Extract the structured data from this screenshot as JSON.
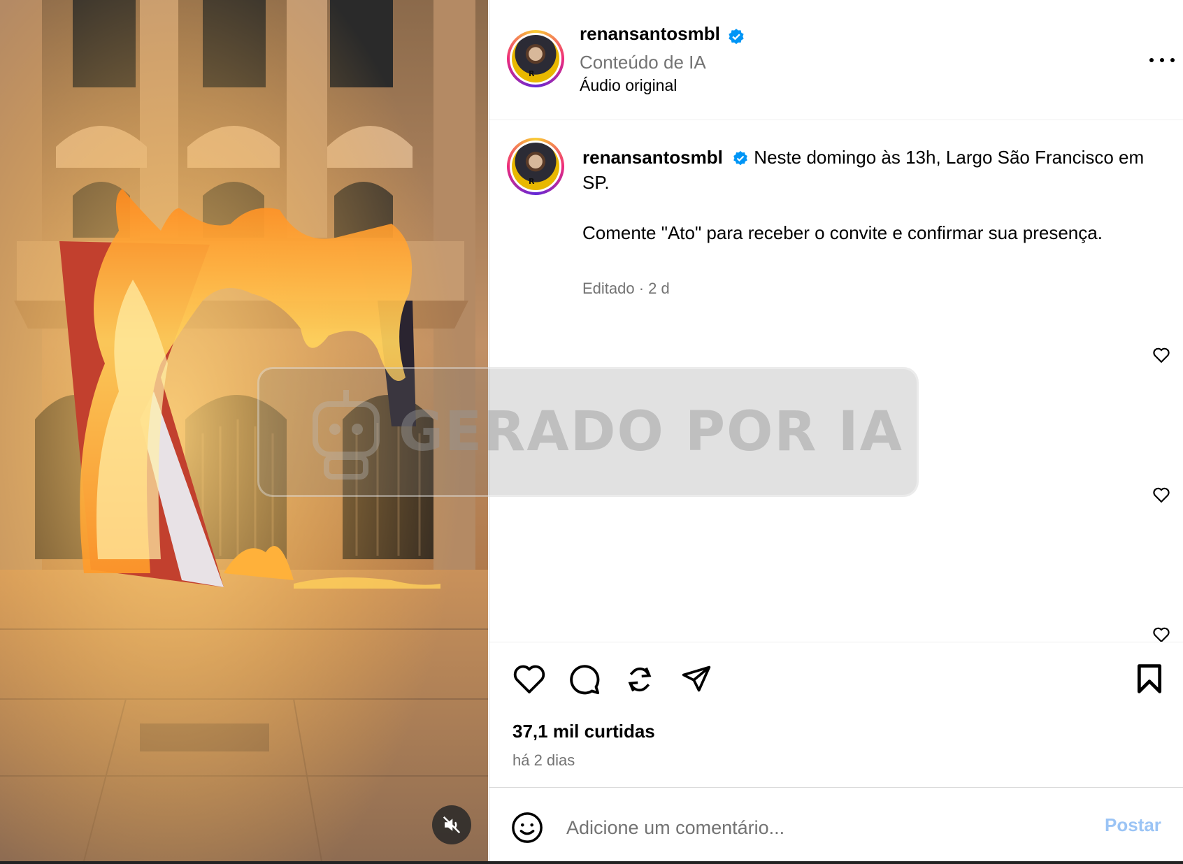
{
  "header": {
    "username": "renansantosmbl",
    "sub_label": "Conteúdo de IA",
    "audio_label": "Áudio original"
  },
  "caption": {
    "username": "renansantosmbl",
    "line1": "Neste domingo às 13h, Largo São Francisco em SP.",
    "line2": "Comente \"Ato\" para receber o convite e confirmar sua presença.",
    "meta": "Editado · 2 d"
  },
  "watermark": {
    "text": "GERADO POR IA"
  },
  "actions": {
    "likes": "37,1 mil curtidas",
    "time": "há 2 dias"
  },
  "comment": {
    "placeholder": "Adicione um comentário...",
    "post_label": "Postar"
  },
  "colors": {
    "verified": "#0095f6",
    "muted_text": "#737373",
    "post_button": "#9bc4f5"
  }
}
